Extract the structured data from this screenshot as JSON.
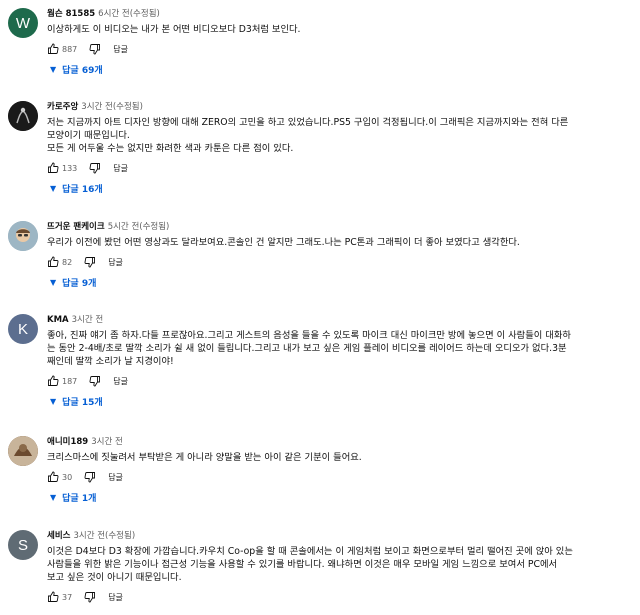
{
  "comments": [
    {
      "author": "웜슨 81585",
      "time": "6시간 전(수정됨)",
      "avatar": {
        "letter": "W",
        "color": "#1e6a4c"
      },
      "lines": [
        "이상하게도 이 비디오는 내가 본 어떤 비디오보다 D3처럼 보인다."
      ],
      "likes": "887",
      "reply_label": "답글",
      "replies_label": "답글 69개"
    },
    {
      "author": "카로주앙",
      "time": "3시간 전(수정됨)",
      "avatar": {
        "letter": "",
        "color": "#1a1a1a"
      },
      "lines": [
        "저는 지금까지 아트 디자인 방향에 대해 ZERO의 고민을 하고 있었습니다.PS5 구입이 걱정됩니다.이 그래픽은 지금까지와는 전혀 다른",
        "모양이기 때문입니다.",
        "모든 게 어두울 수는 없지만 화려한 색과 카툰은 다른 점이 있다."
      ],
      "likes": "133",
      "reply_label": "답글",
      "replies_label": "답글 16개"
    },
    {
      "author": "뜨거운 팬케이크",
      "time": "5시간 전(수정됨)",
      "avatar": {
        "letter": "",
        "color": "#8fa8b8"
      },
      "lines": [
        "우리가 이전에 봤던 어떤 영상과도 달라보여요.콘솔인 건 알지만 그래도.나는 PC톤과 그래픽이 더 좋아 보였다고 생각한다."
      ],
      "likes": "82",
      "reply_label": "답글",
      "replies_label": "답글 9개"
    },
    {
      "author": "KMA",
      "time": "3시간 전",
      "avatar": {
        "letter": "K",
        "color": "#5c6e8f"
      },
      "lines": [
        "좋아, 진짜 얘기 좀 하자.다들 프로잖아요.그리고 게스트의 음성을 들을 수 있도록 마이크 대신 마이크만 방에 놓으면 이 사람들이 대화하",
        "는 동안 2-4배/초로 딸깍 소리가 쉴 새 없이 들립니다.그리고 내가 보고 싶은 게임 플레이 비디오를 레이어드 하는데 오디오가 없다.3분",
        "째인데 딸깍 소리가 날 지경이야!"
      ],
      "likes": "187",
      "reply_label": "답글",
      "replies_label": "답글 15개"
    },
    {
      "author": "애니미189",
      "time": "3시간 전",
      "avatar": {
        "letter": "",
        "color": "#7a5a3c"
      },
      "lines": [
        "크리스마스에 짓눌려서 부탁받은 게 아니라 양말을 받는 아이 같은 기분이 들어요."
      ],
      "likes": "30",
      "reply_label": "답글",
      "replies_label": "답글 1개"
    },
    {
      "author": "세비스",
      "time": "3시간 전(수정됨)",
      "avatar": {
        "letter": "S",
        "color": "#5f6b74"
      },
      "lines": [
        "이것은 D4보다 D3 확장에 가깝습니다.카우치 Co-op을 할 때 콘솔에서는 이 게임처럼 보이고 화면으로부터 멀리 떨어진 곳에 앉아 있는",
        "사람들을 위한 밝은 기능이나 접근성 기능을 사용할 수 있기를 바랍니다. 왜냐하면 이것은 매우 모바일 게임 느낌으로 보여서 PC에서",
        "보고 싶은 것이 아니기 때문입니다."
      ],
      "likes": "37",
      "reply_label": "답글"
    }
  ]
}
